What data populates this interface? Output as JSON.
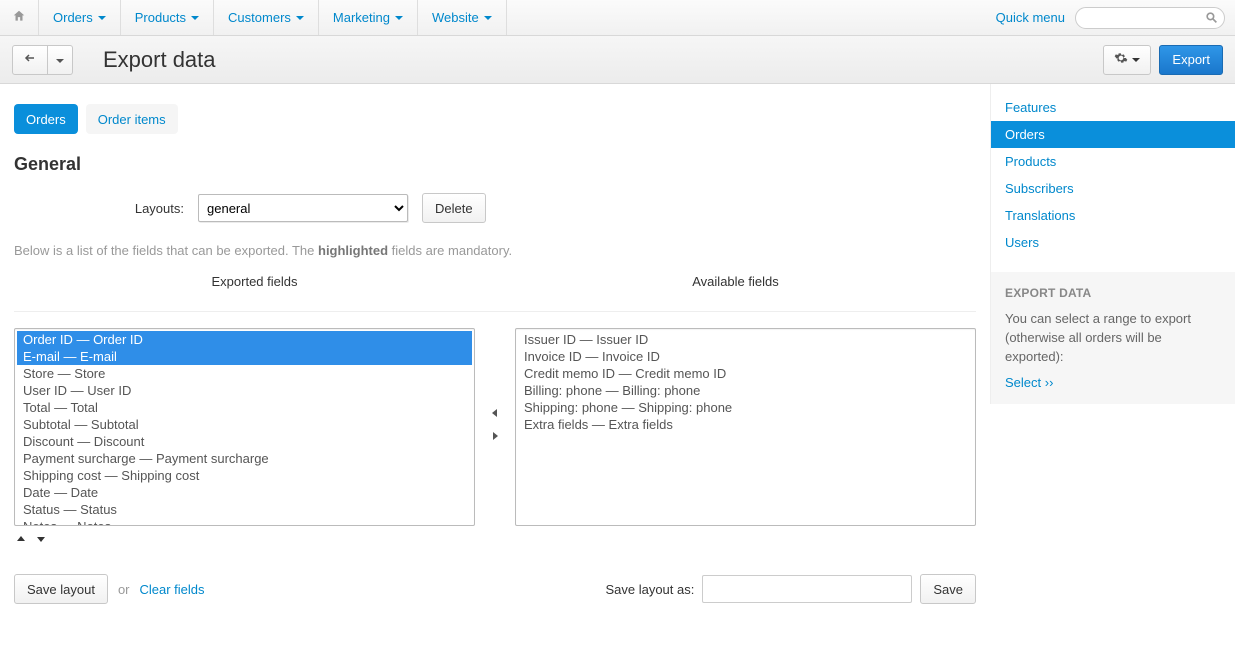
{
  "topnav": {
    "items": [
      "Orders",
      "Products",
      "Customers",
      "Marketing",
      "Website"
    ],
    "quick_menu_label": "Quick menu",
    "search_placeholder": ""
  },
  "header": {
    "title": "Export data",
    "export_button": "Export"
  },
  "tabs": {
    "orders": "Orders",
    "order_items": "Order items"
  },
  "general": {
    "heading": "General",
    "layouts_label": "Layouts:",
    "layouts_selected": "general",
    "delete_button": "Delete",
    "help_pre": "Below is a list of the fields that can be exported. The ",
    "help_bold": "highlighted",
    "help_post": " fields are mandatory."
  },
  "dual": {
    "exported_header": "Exported fields",
    "available_header": "Available fields",
    "exported": [
      {
        "label": "Order ID — Order ID",
        "selected": true
      },
      {
        "label": "E-mail — E-mail",
        "selected": true
      },
      {
        "label": "Store — Store",
        "selected": false
      },
      {
        "label": "User ID — User ID",
        "selected": false
      },
      {
        "label": "Total — Total",
        "selected": false
      },
      {
        "label": "Subtotal — Subtotal",
        "selected": false
      },
      {
        "label": "Discount — Discount",
        "selected": false
      },
      {
        "label": "Payment surcharge — Payment surcharge",
        "selected": false
      },
      {
        "label": "Shipping cost — Shipping cost",
        "selected": false
      },
      {
        "label": "Date — Date",
        "selected": false
      },
      {
        "label": "Status — Status",
        "selected": false
      },
      {
        "label": "Notes — Notes",
        "selected": false
      }
    ],
    "available": [
      {
        "label": "Issuer ID — Issuer ID"
      },
      {
        "label": "Invoice ID — Invoice ID"
      },
      {
        "label": "Credit memo ID — Credit memo ID"
      },
      {
        "label": "Billing: phone — Billing: phone"
      },
      {
        "label": "Shipping: phone — Shipping: phone"
      },
      {
        "label": "Extra fields — Extra fields"
      }
    ]
  },
  "footer": {
    "save_layout": "Save layout",
    "or": "or",
    "clear_fields": "Clear fields",
    "save_layout_as_label": "Save layout as:",
    "save_layout_as_value": "",
    "save": "Save"
  },
  "sidebar": {
    "nav": [
      "Features",
      "Orders",
      "Products",
      "Subscribers",
      "Translations",
      "Users"
    ],
    "active_index": 1,
    "block_title": "EXPORT DATA",
    "block_text": "You can select a range to export (otherwise all orders will be exported):",
    "block_link": "Select ››"
  }
}
